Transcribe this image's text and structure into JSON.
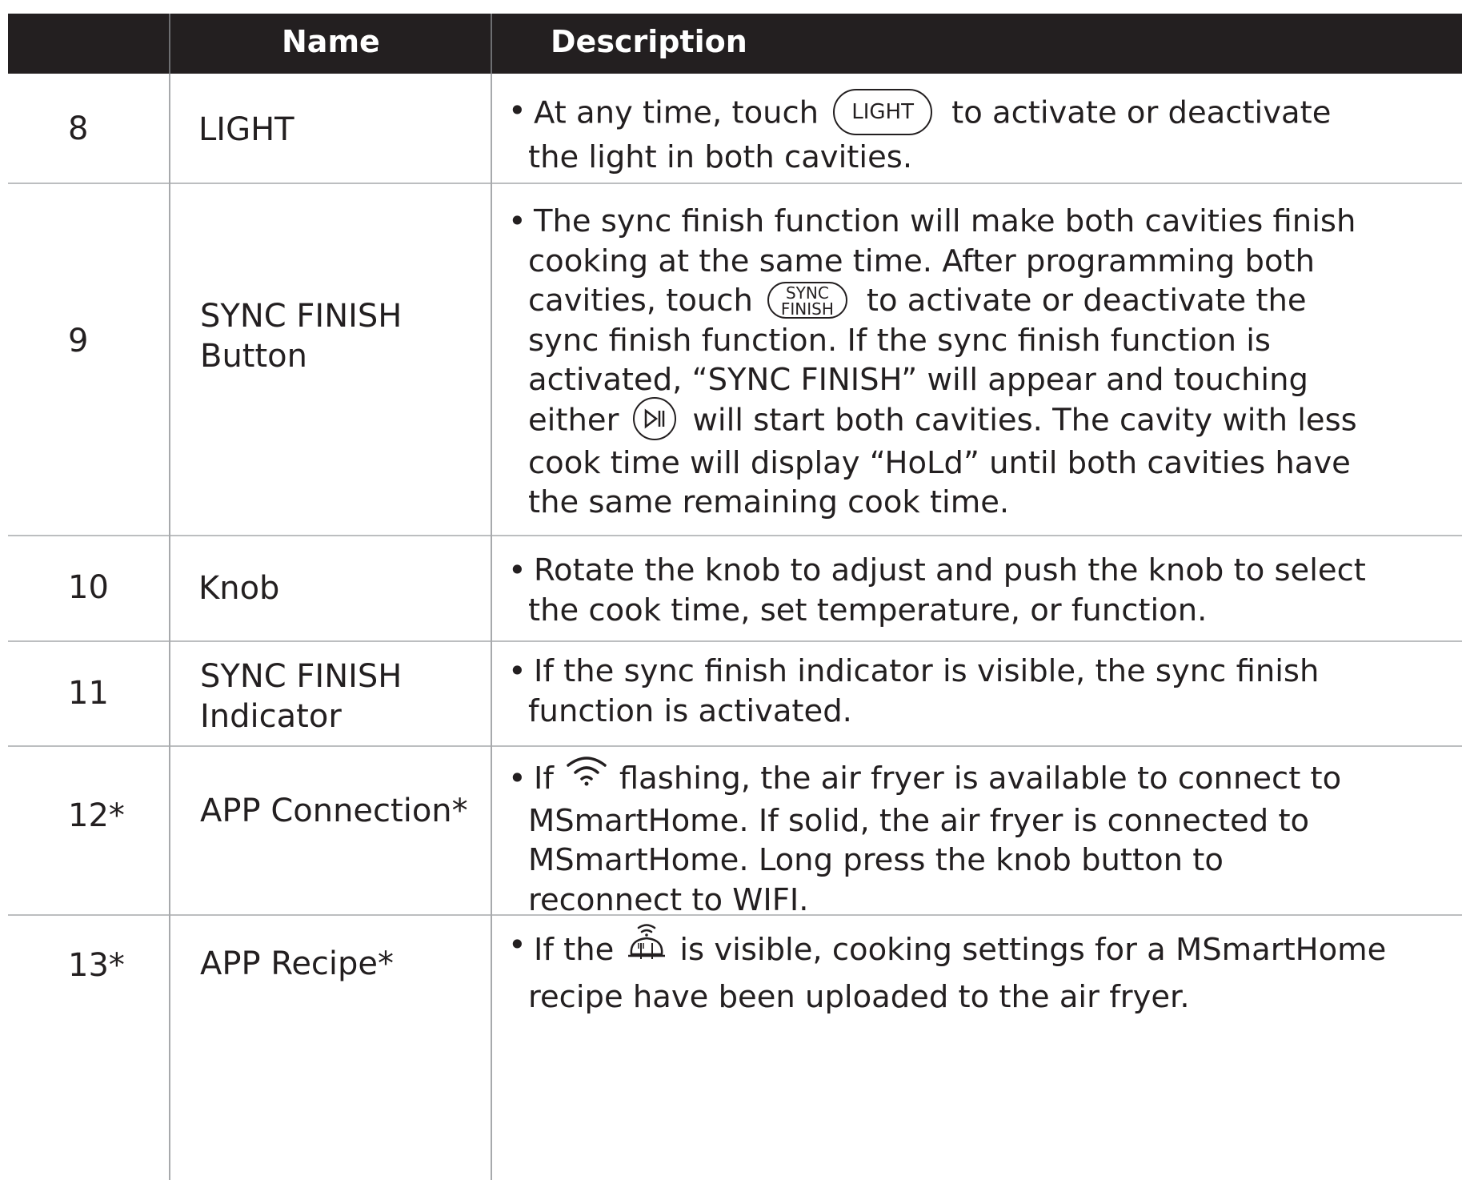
{
  "header": {
    "col_name": "Name",
    "col_description": "Description"
  },
  "rows": [
    {
      "num": "8",
      "name_line1": "LIGHT",
      "name_line2": "",
      "desc_pre": "At any time, touch",
      "desc_button": "LIGHT",
      "desc_post": "to activate or deactivate",
      "desc_line2": "the light in both cavities."
    },
    {
      "num": "9",
      "name_line1": "SYNC FINISH",
      "name_line2": "Button",
      "desc_line1": "The sync finish function will make both cavities finish",
      "desc_line2": "cooking at the same time. After programming both",
      "desc_line3_pre": "cavities, touch",
      "desc_button_top": "SYNC",
      "desc_button_bottom": "FINISH",
      "desc_line3_post": "to activate or deactivate the",
      "desc_line4": "sync finish function. If the sync finish function is",
      "desc_line5": "activated, “SYNC FINISH” will appear and touching",
      "desc_line6_pre": "either",
      "desc_line6_post": "will start both cavities. The cavity with less",
      "desc_line7": "cook time will display “HoLd” until both cavities have",
      "desc_line8": "the same remaining cook time."
    },
    {
      "num": "10",
      "name_line1": "Knob",
      "desc_line1": "Rotate the knob to adjust and push the knob to select",
      "desc_line2": "the cook time, set temperature, or function."
    },
    {
      "num": "11",
      "name_line1": "SYNC FINISH",
      "name_line2": "Indicator",
      "desc_line1": "If the sync finish indicator is visible, the sync finish",
      "desc_line2": "function is activated."
    },
    {
      "num": "12*",
      "name_line1": "APP Connection*",
      "desc_line1_pre": "If",
      "desc_line1_post": "flashing, the air fryer is available to connect to",
      "desc_line2": "MSmartHome. If solid, the air fryer is connected to",
      "desc_line3": "MSmartHome. Long press the knob button to",
      "desc_line4": "reconnect to WIFI."
    },
    {
      "num": "13*",
      "name_line1": "APP Recipe*",
      "desc_line1_pre": "If the",
      "desc_line1_post": "is visible, cooking settings for a MSmartHome",
      "desc_line2": "recipe have been uploaded to the air fryer."
    }
  ],
  "icons": {
    "play_pause": "play-pause-icon",
    "wifi": "wifi-icon",
    "recipe": "app-recipe-icon"
  },
  "colors": {
    "header_bg": "#231f20",
    "header_text": "#ffffff",
    "grid": "#bcbec0",
    "text": "#231f20"
  }
}
